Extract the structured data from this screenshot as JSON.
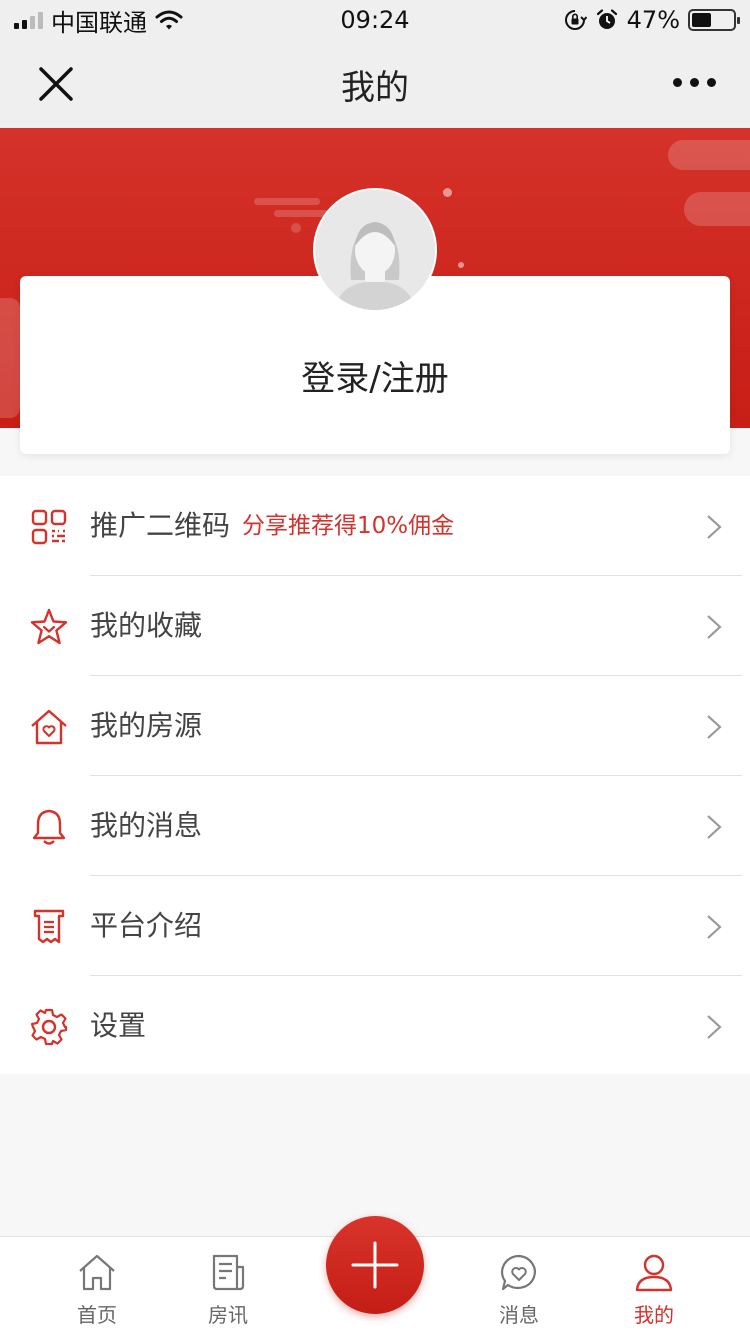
{
  "status_bar": {
    "carrier": "中国联通",
    "time": "09:24",
    "battery_percent": "47%",
    "battery_level": 0.47
  },
  "nav": {
    "title": "我的",
    "close_icon": "close-icon",
    "more_icon": "more-icon"
  },
  "profile": {
    "login_label": "登录/注册",
    "avatar_icon": "avatar-placeholder-icon"
  },
  "menu": {
    "items": [
      {
        "label": "推广二维码",
        "promo": "分享推荐得10%佣金",
        "icon": "qrcode-icon"
      },
      {
        "label": "我的收藏",
        "icon": "star-icon"
      },
      {
        "label": "我的房源",
        "icon": "house-heart-icon"
      },
      {
        "label": "我的消息",
        "icon": "bell-icon"
      },
      {
        "label": "平台介绍",
        "icon": "scroll-icon"
      },
      {
        "label": "设置",
        "icon": "gear-icon"
      }
    ]
  },
  "tabs": [
    {
      "label": "首页",
      "icon": "home-icon",
      "active": false
    },
    {
      "label": "房讯",
      "icon": "news-icon",
      "active": false
    },
    {
      "label": "消息",
      "icon": "chat-heart-icon",
      "active": false
    },
    {
      "label": "我的",
      "icon": "user-icon",
      "active": true
    }
  ],
  "colors": {
    "accent": "#d4322a",
    "background": "#f7f7f7",
    "nav_background": "#efefef"
  },
  "fab": {
    "icon": "plus-icon"
  }
}
